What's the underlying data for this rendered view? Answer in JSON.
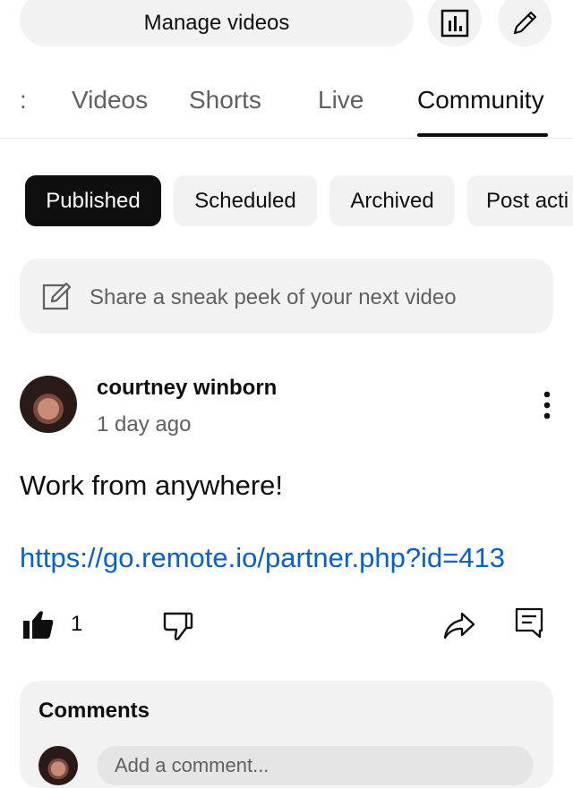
{
  "header": {
    "manage_videos_label": "Manage videos",
    "analytics_icon": "analytics-icon",
    "edit_icon": "pencil-icon"
  },
  "tabs": [
    {
      "label": "Videos",
      "active": false
    },
    {
      "label": "Shorts",
      "active": false
    },
    {
      "label": "Live",
      "active": false
    },
    {
      "label": "Community",
      "active": true
    }
  ],
  "chips": [
    {
      "label": "Published",
      "selected": true
    },
    {
      "label": "Scheduled",
      "selected": false
    },
    {
      "label": "Archived",
      "selected": false
    },
    {
      "label": "Post acti",
      "selected": false
    }
  ],
  "composer": {
    "placeholder": "Share a sneak peek of your next video"
  },
  "post": {
    "author": "courtney winborn",
    "time": "1 day ago",
    "text": "Work from anywhere!",
    "link": "https://go.remote.io/partner.php?id=413",
    "like_count": "1"
  },
  "comments": {
    "title": "Comments",
    "input_placeholder": "Add a comment..."
  },
  "colors": {
    "link": "#065fd4",
    "chip_selected": "#0f0f0f",
    "surface": "#f2f2f2"
  }
}
